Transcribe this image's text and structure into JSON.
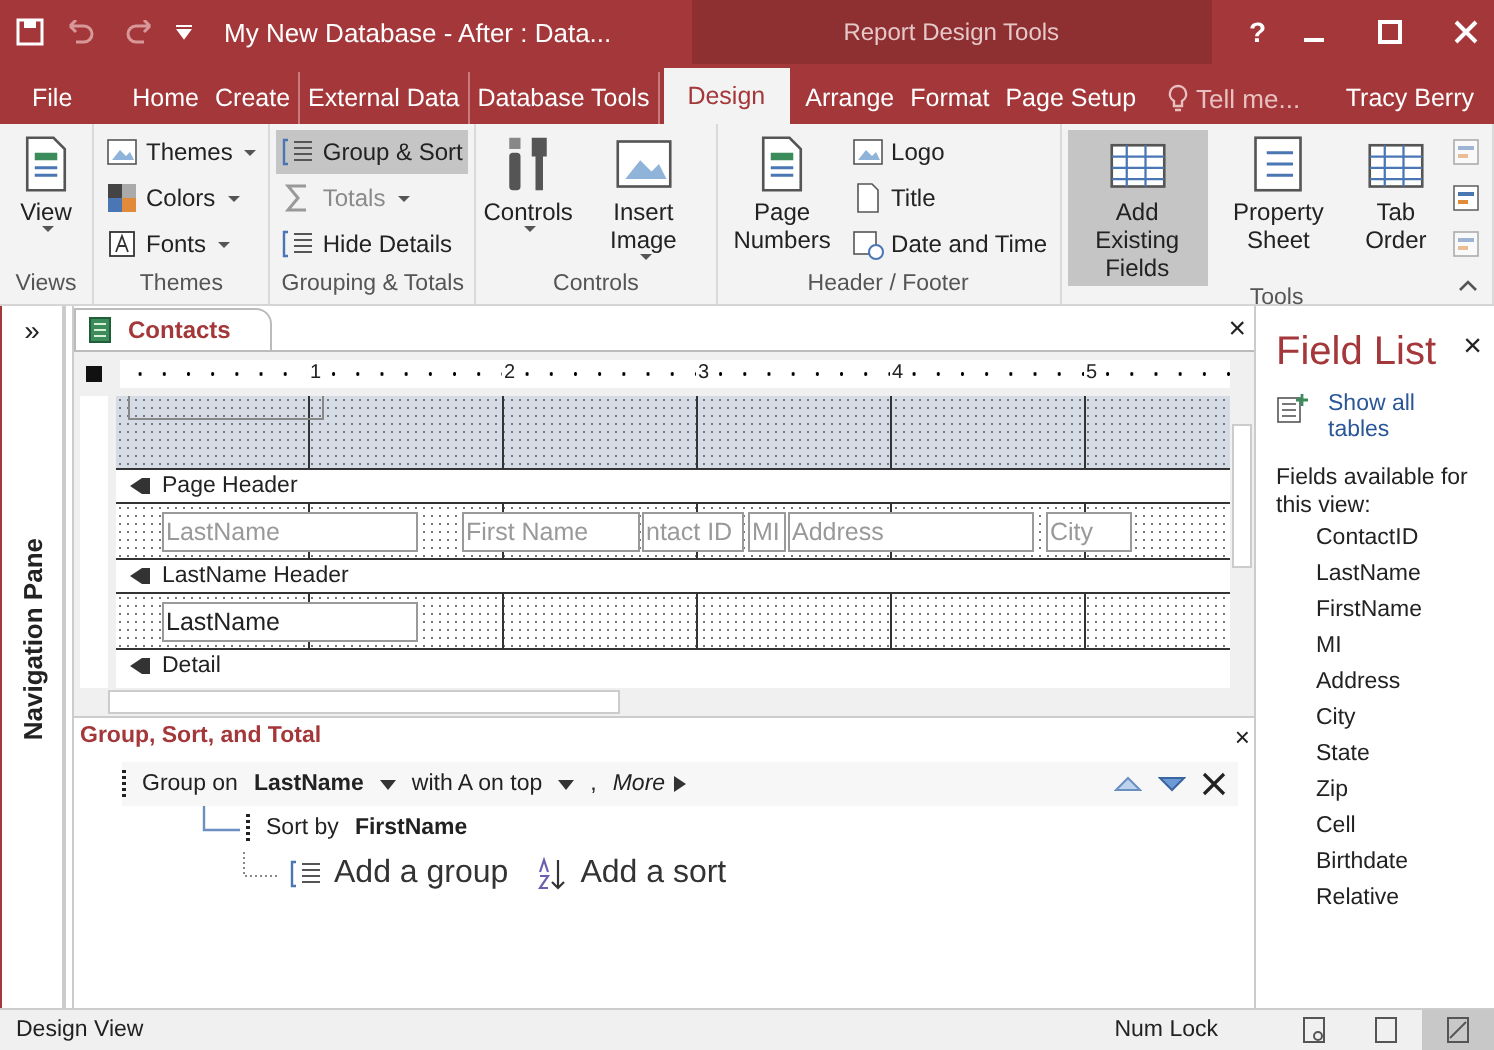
{
  "title_bar": {
    "title": "My New Database - After : Data...",
    "context": "Report Design Tools",
    "help": "?"
  },
  "menu_tabs": [
    {
      "label": "File",
      "selected": false
    },
    {
      "label": "Home",
      "selected": false
    },
    {
      "label": "Create",
      "selected": false
    },
    {
      "label": "External Data",
      "selected": false
    },
    {
      "label": "Database Tools",
      "selected": false
    },
    {
      "label": "Design",
      "selected": true
    },
    {
      "label": "Arrange",
      "selected": false
    },
    {
      "label": "Format",
      "selected": false
    },
    {
      "label": "Page Setup",
      "selected": false
    }
  ],
  "tell_me": {
    "placeholder": "Tell me..."
  },
  "user": "Tracy Berry",
  "ribbon": {
    "groups": [
      {
        "label": "Views",
        "items": [
          {
            "kind": "large",
            "label": "View",
            "dropdown": true,
            "selected": false,
            "disabled": false
          }
        ]
      },
      {
        "label": "Themes",
        "items": [
          {
            "kind": "small",
            "label": "Themes",
            "dropdown": true,
            "selected": false,
            "disabled": false
          },
          {
            "kind": "small",
            "label": "Colors",
            "dropdown": true,
            "selected": false,
            "disabled": false
          },
          {
            "kind": "small",
            "label": "Fonts",
            "dropdown": true,
            "selected": false,
            "disabled": false
          }
        ]
      },
      {
        "label": "Grouping & Totals",
        "items": [
          {
            "kind": "small",
            "label": "Group & Sort",
            "dropdown": false,
            "selected": true,
            "disabled": false
          },
          {
            "kind": "small",
            "label": "Totals",
            "dropdown": true,
            "selected": false,
            "disabled": true
          },
          {
            "kind": "small",
            "label": "Hide Details",
            "dropdown": false,
            "selected": false,
            "disabled": false
          }
        ]
      },
      {
        "label": "Controls",
        "items": [
          {
            "kind": "large",
            "label": "Controls",
            "dropdown": true,
            "selected": false,
            "disabled": false
          },
          {
            "kind": "large",
            "label": "Insert Image",
            "dropdown": true,
            "selected": false,
            "disabled": false
          }
        ]
      },
      {
        "label": "Header / Footer",
        "items": [
          {
            "kind": "large",
            "label": "Page Numbers",
            "dropdown": false,
            "selected": false,
            "disabled": false
          },
          {
            "kind": "small",
            "label": "Logo",
            "dropdown": false,
            "selected": false,
            "disabled": false
          },
          {
            "kind": "small",
            "label": "Title",
            "dropdown": false,
            "selected": false,
            "disabled": false
          },
          {
            "kind": "small",
            "label": "Date and Time",
            "dropdown": false,
            "selected": false,
            "disabled": false
          }
        ]
      },
      {
        "label": "Tools",
        "items": [
          {
            "kind": "large",
            "label": "Add Existing Fields",
            "dropdown": false,
            "selected": true,
            "disabled": false
          },
          {
            "kind": "large",
            "label": "Property Sheet",
            "dropdown": false,
            "selected": false,
            "disabled": false
          },
          {
            "kind": "large",
            "label": "Tab Order",
            "dropdown": false,
            "selected": false,
            "disabled": false
          },
          {
            "kind": "icon",
            "disabled": true
          },
          {
            "kind": "icon",
            "disabled": false
          },
          {
            "kind": "icon",
            "disabled": true
          }
        ]
      }
    ]
  },
  "nav_pane": {
    "expand": "»",
    "label": "Navigation Pane"
  },
  "document": {
    "tab": "Contacts",
    "close": "×",
    "ruler": [
      "1",
      "2",
      "3",
      "4",
      "5"
    ],
    "sections": [
      {
        "title": "Page Header",
        "controls": [
          {
            "kind": "label",
            "text": "LastName"
          },
          {
            "kind": "label",
            "text": "First Name"
          },
          {
            "kind": "label",
            "text": "ntact ID"
          },
          {
            "kind": "label",
            "text": "MI"
          },
          {
            "kind": "label",
            "text": "Address"
          },
          {
            "kind": "label",
            "text": "City"
          }
        ]
      },
      {
        "title": "LastName Header",
        "controls": [
          {
            "kind": "textbox",
            "text": "LastName"
          }
        ]
      },
      {
        "title": "Detail"
      }
    ]
  },
  "group_sort": {
    "title": "Group, Sort, and Total",
    "close": "×",
    "group_row": {
      "prefix": "Group on",
      "field": "LastName",
      "order": "with A on top",
      "separator": ",",
      "more": "More"
    },
    "sort_row": {
      "prefix": "Sort by",
      "field": "FirstName"
    },
    "add_group": "Add a group",
    "add_sort": "Add a sort"
  },
  "field_list": {
    "title": "Field List",
    "close": "×",
    "link": "Show all tables",
    "caption": "Fields available for this view:",
    "fields": [
      "ContactID",
      "LastName",
      "FirstName",
      "MI",
      "Address",
      "City",
      "State",
      "Zip",
      "Cell",
      "Birthdate",
      "Relative"
    ]
  },
  "status_bar": {
    "text": "Design View",
    "num_lock": "Num Lock",
    "views": [
      {
        "selected": false
      },
      {
        "selected": false
      },
      {
        "selected": true
      }
    ]
  }
}
